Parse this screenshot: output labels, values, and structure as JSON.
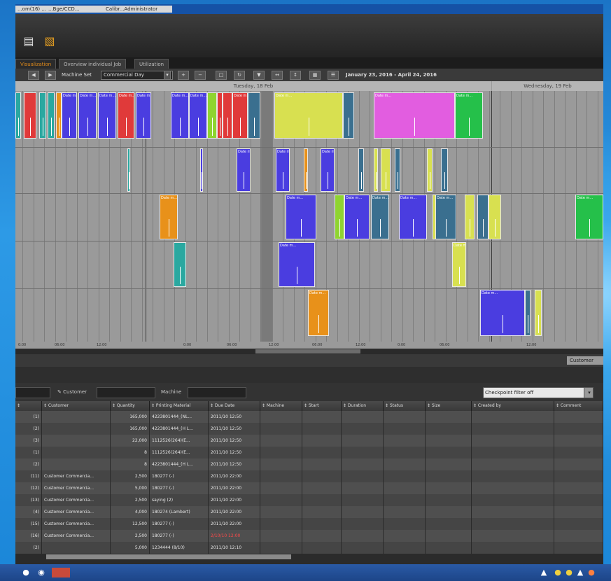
{
  "window": {
    "title_tabs": [
      "...om(16) ...",
      "...Bge/CCD...",
      "Calibr...Administrator"
    ]
  },
  "toolbar": {
    "icons": [
      "document-icon",
      "printer-icon"
    ]
  },
  "tabs": [
    {
      "label": "Visualization",
      "active": true
    },
    {
      "label": "Overview individual Job",
      "active": false
    },
    {
      "label": "Utilization",
      "active": false
    }
  ],
  "subbar": {
    "machine_set_label": "Machine Set",
    "machine_set_value": "Commercial Day",
    "date_range": "January 23, 2016 - April 24, 2016"
  },
  "gantt": {
    "day_headers": [
      "Tuesday, 18 Feb",
      "Wednesday, 19 Feb"
    ],
    "axis_ticks": [
      "0:00",
      "06:00",
      "12:00",
      "0:00",
      "06:00",
      "12:00",
      "06:00",
      "12:00",
      "0:00",
      "06:00",
      "12:00"
    ],
    "colors": {
      "blue": "#4a3de0",
      "teal": "#2aa8a0",
      "red": "#e03a3a",
      "orange": "#e8911a",
      "yellow": "#d8e050",
      "magenta": "#e25de0",
      "green": "#25c04a",
      "slate": "#3a6f8f",
      "lime": "#8fd430"
    },
    "job_label": "Date m..."
  },
  "middle": {
    "button_label": "Customer"
  },
  "filter": {
    "customer_label": "Customer",
    "machine_label": "Machine",
    "checkpoint_value": "Checkpoint filter off"
  },
  "table": {
    "headers": [
      "",
      "Customer",
      "Quantity",
      "Printing Material",
      "Due Date",
      "Machine",
      "Start",
      "Duration",
      "Status",
      "Size",
      "Created by",
      "Comment"
    ],
    "rows": [
      [
        "(1)",
        "",
        "165,000",
        "4223801444_(NL...",
        "2011/10 12:50",
        "",
        "",
        "",
        "",
        "",
        "",
        ""
      ],
      [
        "(2)",
        "",
        "165,000",
        "4223801444_(H L...",
        "2011/10 12:50",
        "",
        "",
        "",
        "",
        "",
        "",
        ""
      ],
      [
        "(3)",
        "",
        "22,000",
        "1112526(264)(E...",
        "2011/10 12:50",
        "",
        "",
        "",
        "",
        "",
        "",
        ""
      ],
      [
        "(1)",
        "",
        "8",
        "1112526(264)(E...",
        "2011/10 12:50",
        "",
        "",
        "",
        "",
        "",
        "",
        ""
      ],
      [
        "(2)",
        "",
        "8",
        "4223801444_(H L...",
        "2011/10 12:50",
        "",
        "",
        "",
        "",
        "",
        "",
        ""
      ],
      [
        "(11)",
        "Customer Commercia...",
        "2,500",
        "180277 (-)",
        "2011/10 22:00",
        "",
        "",
        "",
        "",
        "",
        "",
        ""
      ],
      [
        "(12)",
        "Customer Commercia...",
        "5,000",
        "180277 (-)",
        "2011/10 22:00",
        "",
        "",
        "",
        "",
        "",
        "",
        ""
      ],
      [
        "(13)",
        "Customer Commercia...",
        "2,500",
        "saying (2)",
        "2011/10 22:00",
        "",
        "",
        "",
        "",
        "",
        "",
        ""
      ],
      [
        "(4)",
        "Customer Commercia...",
        "4,000",
        "180274 (Lambert)",
        "2011/10 22:00",
        "",
        "",
        "",
        "",
        "",
        "",
        ""
      ],
      [
        "(15)",
        "Customer Commercia...",
        "12,500",
        "180277 (-)",
        "2011/10 22:00",
        "",
        "",
        "",
        "",
        "",
        "",
        ""
      ],
      [
        "(16)",
        "Customer Commercia...",
        "2,500",
        "180277 (-)",
        "2/10/10 12:00",
        "",
        "",
        "",
        "",
        "",
        "",
        ""
      ],
      [
        "(2)",
        "",
        "5,000",
        "1234444 (8/10)",
        "2011/10 12:10",
        "",
        "",
        "",
        "",
        "",
        "",
        ""
      ]
    ]
  }
}
